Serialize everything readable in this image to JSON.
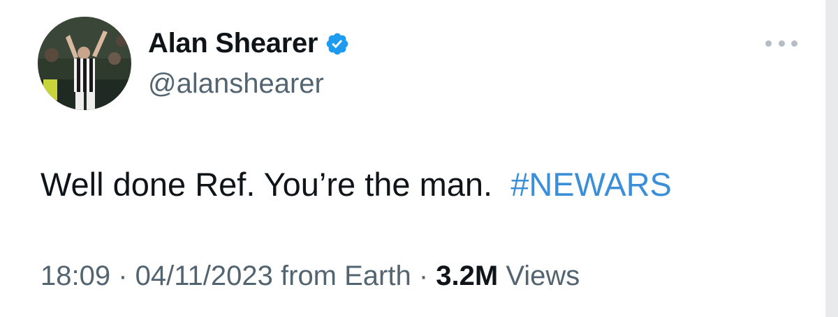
{
  "author": {
    "display_name": "Alan Shearer",
    "handle": "@alanshearer",
    "verified": true,
    "avatar": "avatar-photo-footballer-celebrating"
  },
  "more_button": {
    "icon": "more-dots-icon"
  },
  "tweet": {
    "text": "Well done Ref. You’re the man.  ",
    "hashtag": "#NEWARS"
  },
  "meta": {
    "time": "18:09",
    "separator1": " · ",
    "date": "04/11/2023",
    "source": " from Earth",
    "separator2": " · ",
    "views_count": "3.2M",
    "views_label": " Views"
  },
  "colors": {
    "verified_badge": "#1d9bf0",
    "hashtag": "#3b8fd9",
    "text_primary": "#0f1419",
    "text_secondary": "#536471"
  }
}
